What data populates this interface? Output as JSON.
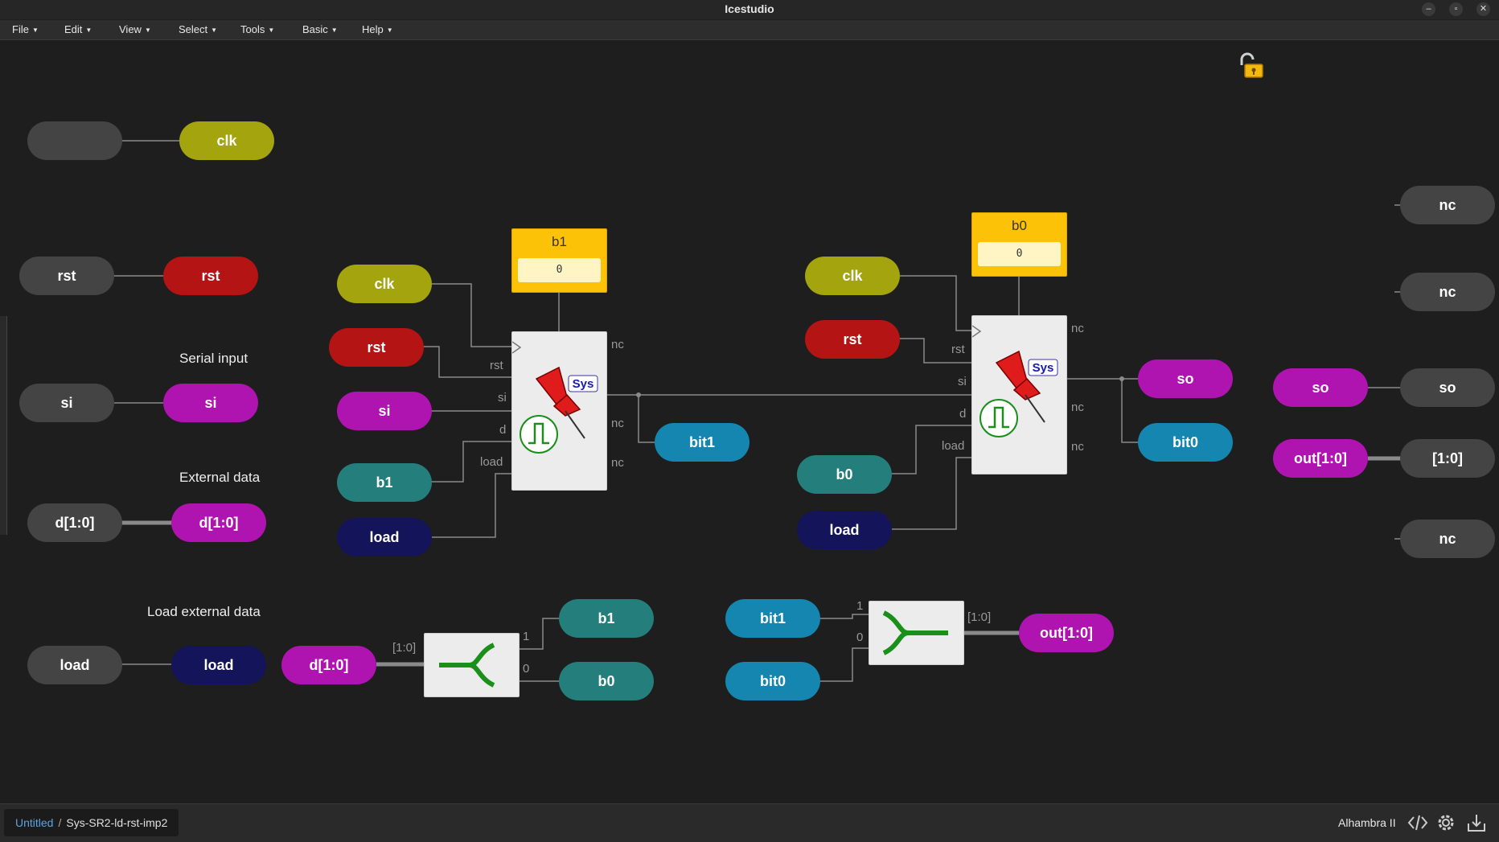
{
  "window": {
    "title": "Icestudio",
    "minimize": "–",
    "restore": "▫",
    "close": "✕"
  },
  "menu": [
    {
      "label": "File"
    },
    {
      "label": "Edit"
    },
    {
      "label": "View"
    },
    {
      "label": "Select"
    },
    {
      "label": "Tools"
    },
    {
      "label": "Basic"
    },
    {
      "label": "Help"
    }
  ],
  "colors": {
    "clk": "#a4a40e",
    "rst": "#b41414",
    "si": "#b014b0",
    "d": "#b014b0",
    "load": "#14145a",
    "b": "#247f7c",
    "bit": "#1486b0",
    "out": "#b014b0",
    "so": "#b014b0",
    "io": "#444444",
    "register": "#fcc207"
  },
  "canvas": {
    "inputs": {
      "clk": {
        "name": "",
        "label": "clk"
      },
      "rst": {
        "name": "rst",
        "label": "rst"
      },
      "si": {
        "name": "si",
        "label": "si"
      },
      "d": {
        "name": "d[1:0]",
        "label": "d[1:0]"
      },
      "load": {
        "name": "load",
        "label": "load"
      }
    },
    "comments": {
      "serial": "Serial input",
      "external": "External data",
      "load": "Load external data"
    },
    "stage1": {
      "reg_name": "b1",
      "reg_value": "0",
      "clk": "clk",
      "rst": "rst",
      "si": "si",
      "d": "b1",
      "load": "load",
      "out": "bit1",
      "ports": {
        "rst": "rst",
        "si": "si",
        "d": "d",
        "load": "load",
        "nc1": "nc",
        "nc2": "nc",
        "nc3": "nc"
      },
      "badge": "Sys"
    },
    "stage0": {
      "reg_name": "b0",
      "reg_value": "0",
      "clk": "clk",
      "rst": "rst",
      "d": "b0",
      "load": "load",
      "so": "so",
      "out": "bit0",
      "ports": {
        "rst": "rst",
        "si": "si",
        "d": "d",
        "load": "load",
        "nc1": "nc",
        "nc2": "nc",
        "nc3": "nc"
      },
      "badge": "Sys"
    },
    "split": {
      "in": "d[1:0]",
      "bus": "[1:0]",
      "p1": "1",
      "p0": "0",
      "out1": "b1",
      "out0": "b0"
    },
    "join": {
      "in1": "bit1",
      "in0": "bit0",
      "p1": "1",
      "p0": "0",
      "bus": "[1:0]",
      "out": "out[1:0]"
    },
    "outputs": {
      "nc1": "nc",
      "nc2": "nc",
      "so_label": "so",
      "so_name": "so",
      "out_label": "out[1:0]",
      "out_name": "[1:0]",
      "nc3": "nc"
    }
  },
  "status": {
    "root": "Untitled",
    "sep": "/",
    "current": "Sys-SR2-ld-rst-imp2",
    "board": "Alhambra II"
  }
}
